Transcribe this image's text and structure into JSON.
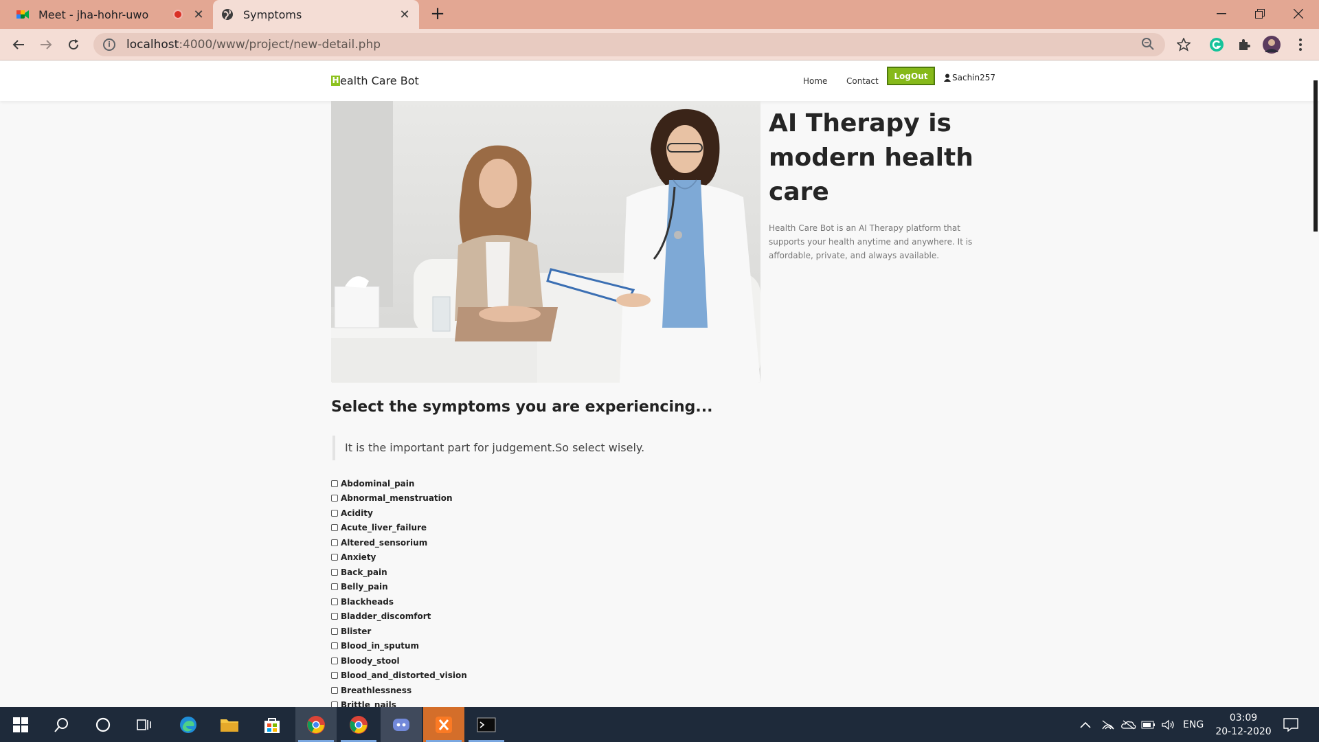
{
  "browser": {
    "tabs": [
      {
        "title": "Meet - jha-hohr-uwo",
        "recording": true
      },
      {
        "title": "Symptoms",
        "active": true
      }
    ],
    "url_host": "localhost",
    "url_rest": ":4000/www/project/new-detail.php"
  },
  "site": {
    "brand_initial": "H",
    "brand_rest": "ealth Care Bot",
    "nav": {
      "home": "Home",
      "contact": "Contact",
      "logout": "LogOut",
      "user": "Sachin257"
    },
    "hero": {
      "title": "AI Therapy is modern health care",
      "description": "Health Care Bot is an AI Therapy platform that supports your health anytime and anywhere. It is affordable, private, and always available."
    },
    "section_title": "Select the symptoms you are experiencing...",
    "note": "It is the important part for judgement.So select wisely.",
    "symptoms": [
      "Abdominal_pain",
      "Abnormal_menstruation",
      "Acidity",
      "Acute_liver_failure",
      "Altered_sensorium",
      "Anxiety",
      "Back_pain",
      "Belly_pain",
      "Blackheads",
      "Bladder_discomfort",
      "Blister",
      "Blood_in_sputum",
      "Bloody_stool",
      "Blood_and_distorted_vision",
      "Breathlessness",
      "Brittle_nails"
    ]
  },
  "taskbar": {
    "language": "ENG",
    "time": "03:09",
    "date": "20-12-2020"
  },
  "colors": {
    "accent_green": "#86b91a",
    "tab_bar": "#e3a793",
    "taskbar": "#1e2a3a"
  }
}
